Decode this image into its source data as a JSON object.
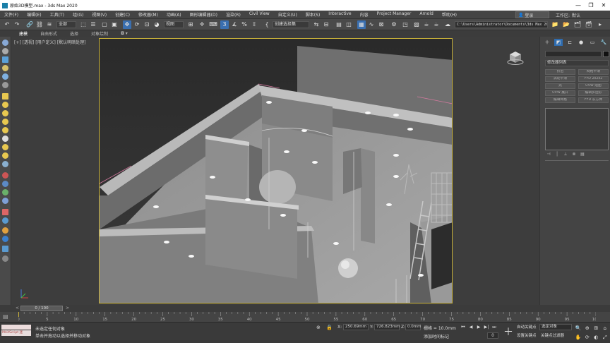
{
  "window": {
    "title": "原始3D模型.max - 3ds Max 2020",
    "controls": [
      "—",
      "❐",
      "✕"
    ]
  },
  "menubar": {
    "items": [
      "文件(F)",
      "编辑(E)",
      "工具(T)",
      "组(G)",
      "视图(V)",
      "创建(C)",
      "修改器(M)",
      "动画(A)",
      "图形编辑器(D)",
      "渲染(R)",
      "Civil View",
      "自定义(U)",
      "脚本(S)",
      "Interactive",
      "内容",
      "Project Manager",
      "Arnold",
      "帮助(H)"
    ],
    "signin": "登录",
    "workspace_label": "工作区:",
    "workspace_value": "默认"
  },
  "toolbar": {
    "filter_dropdown": "全部",
    "view_dropdown": "视图",
    "selection_set": "创建选择集",
    "project_path": "C:\\Users\\Administrator\\Documents\\3ds Max 2020"
  },
  "ribbon": {
    "tabs": [
      "建模",
      "自由形式",
      "选择",
      "对象绘制"
    ],
    "extra": "◘ ▾"
  },
  "viewport": {
    "label": "[+] [透视] [用户定义] [默认明暗处理]"
  },
  "command_panel": {
    "modifier_list": "修改器列表",
    "modifiers": [
      "挤出",
      "网格平滑",
      "涡轮平滑",
      "FFD 2x2x2",
      "壳",
      "UVW 贴图",
      "UVW 展开",
      "编辑多边形",
      "编辑网格",
      "FFD 长方体"
    ],
    "stack_buttons": [
      "⊣",
      "│",
      "⟂",
      "⊗",
      "▤"
    ]
  },
  "timeline": {
    "thumb": "0 / 100",
    "prev": "<",
    "next": ">",
    "ticks": [
      "0",
      "5",
      "10",
      "15",
      "20",
      "25",
      "30",
      "35",
      "40",
      "45",
      "50",
      "55",
      "60",
      "65",
      "70",
      "75",
      "80",
      "85",
      "90",
      "95",
      "100"
    ]
  },
  "status": {
    "maxscript": "MAXScript 迷",
    "selected": "未选定任何对象",
    "hint": "单击并拖动以选择并移动对象",
    "x_label": "X:",
    "x_value": "250.69mm",
    "y_label": "Y:",
    "y_value": "726.823mm",
    "z_label": "Z:",
    "z_value": "0.0mm",
    "grid": "栅格 = 10.0mm",
    "time_tag": "添加时间标记",
    "frame": "0",
    "auto_key": "自动关键点",
    "set_key": "设置关键点",
    "selected_obj": "选定对象",
    "key_filters": "关键点过滤器"
  },
  "playback": [
    "⏮",
    "◀",
    "▶",
    "▶|",
    "⏭"
  ],
  "nav": [
    "🔍",
    "⊕",
    "⊞",
    "⌂",
    "✋",
    "⟳",
    "◐",
    "⤢"
  ]
}
